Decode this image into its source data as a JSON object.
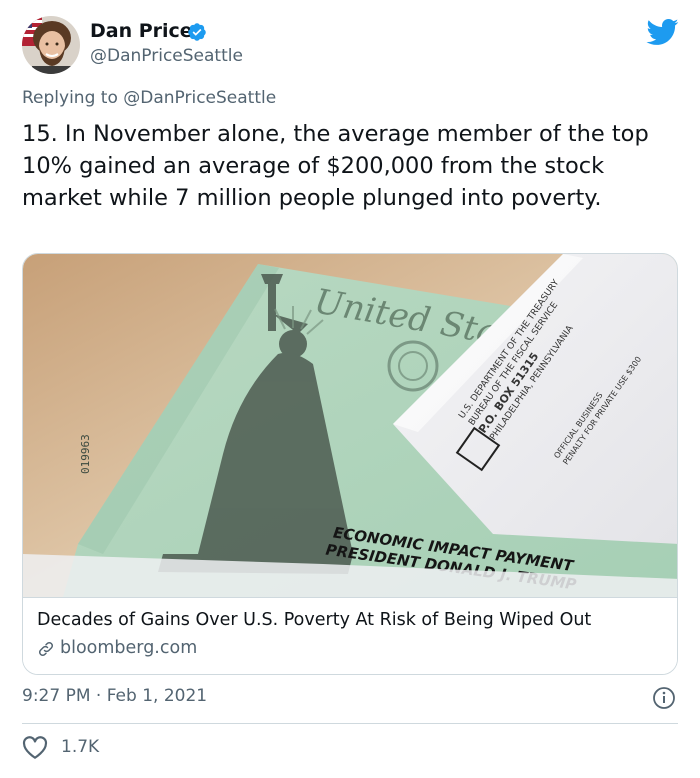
{
  "author": {
    "name": "Dan Price",
    "handle": "@DanPriceSeattle",
    "verified": true
  },
  "reply": {
    "prefix": "Replying to ",
    "mention": "@DanPriceSeattle"
  },
  "tweet": {
    "text": "15. In November alone, the average member of the top 10% gained an average of $200,000 from the stock market while 7 million people plunged into poverty."
  },
  "card": {
    "title": "Decades of Gains Over U.S. Poverty At Risk of Being Wiped Out",
    "domain": "bloomberg.com",
    "image": {
      "check_heading": "United Stat",
      "check_serial": "019963",
      "envelope_lines": [
        "U.S. DEPARTMENT OF THE TREASURY",
        "BUREAU OF THE FISCAL SERVICE",
        "P.O. BOX 51315",
        "PHILADELPHIA, PENNSYLVANIA",
        "OFFICIAL BUSINESS",
        "PENALTY FOR PRIVATE USE $300"
      ],
      "caption_line1": "ECONOMIC IMPACT PAYMENT",
      "caption_line2": "PRESIDENT DONALD J. TRUMP"
    }
  },
  "meta": {
    "timestamp": "9:27 PM · Feb 1, 2021",
    "likes": "1.7K"
  },
  "icons": {
    "platform": "twitter-bird-icon",
    "verified": "verified-badge-icon",
    "info": "info-icon",
    "like": "heart-icon",
    "link": "link-icon"
  },
  "colors": {
    "brand": "#1d9bf0",
    "text": "#0f1419",
    "secondary": "#536471",
    "border": "#cfd9de"
  }
}
